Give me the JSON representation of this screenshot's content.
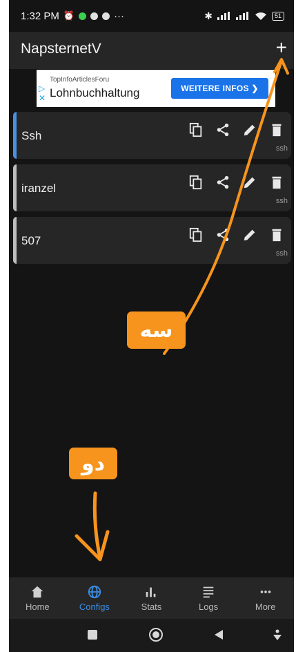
{
  "status": {
    "time": "1:32 PM",
    "more": "···",
    "battery": "51"
  },
  "app": {
    "title": "NapsternetV",
    "add": "+"
  },
  "ad": {
    "sponsor": "TopInfoArticlesForu",
    "headline": "Lohnbuchhaltung",
    "cta": "WEITERE INFOS ❯"
  },
  "configs": [
    {
      "name": "Ssh",
      "type": "ssh",
      "accent": "#4a90e2"
    },
    {
      "name": "iranzel",
      "type": "ssh",
      "accent": "#bdbdbd"
    },
    {
      "name": "507",
      "type": "ssh",
      "accent": "#bdbdbd"
    }
  ],
  "annotations": {
    "top": "سه",
    "bottom": "دو",
    "color": "#f7941d"
  },
  "nav": [
    {
      "label": "Home",
      "icon": "home-icon"
    },
    {
      "label": "Configs",
      "icon": "globe-icon",
      "active": true
    },
    {
      "label": "Stats",
      "icon": "stats-icon"
    },
    {
      "label": "Logs",
      "icon": "logs-icon"
    },
    {
      "label": "More",
      "icon": "more-icon"
    }
  ]
}
